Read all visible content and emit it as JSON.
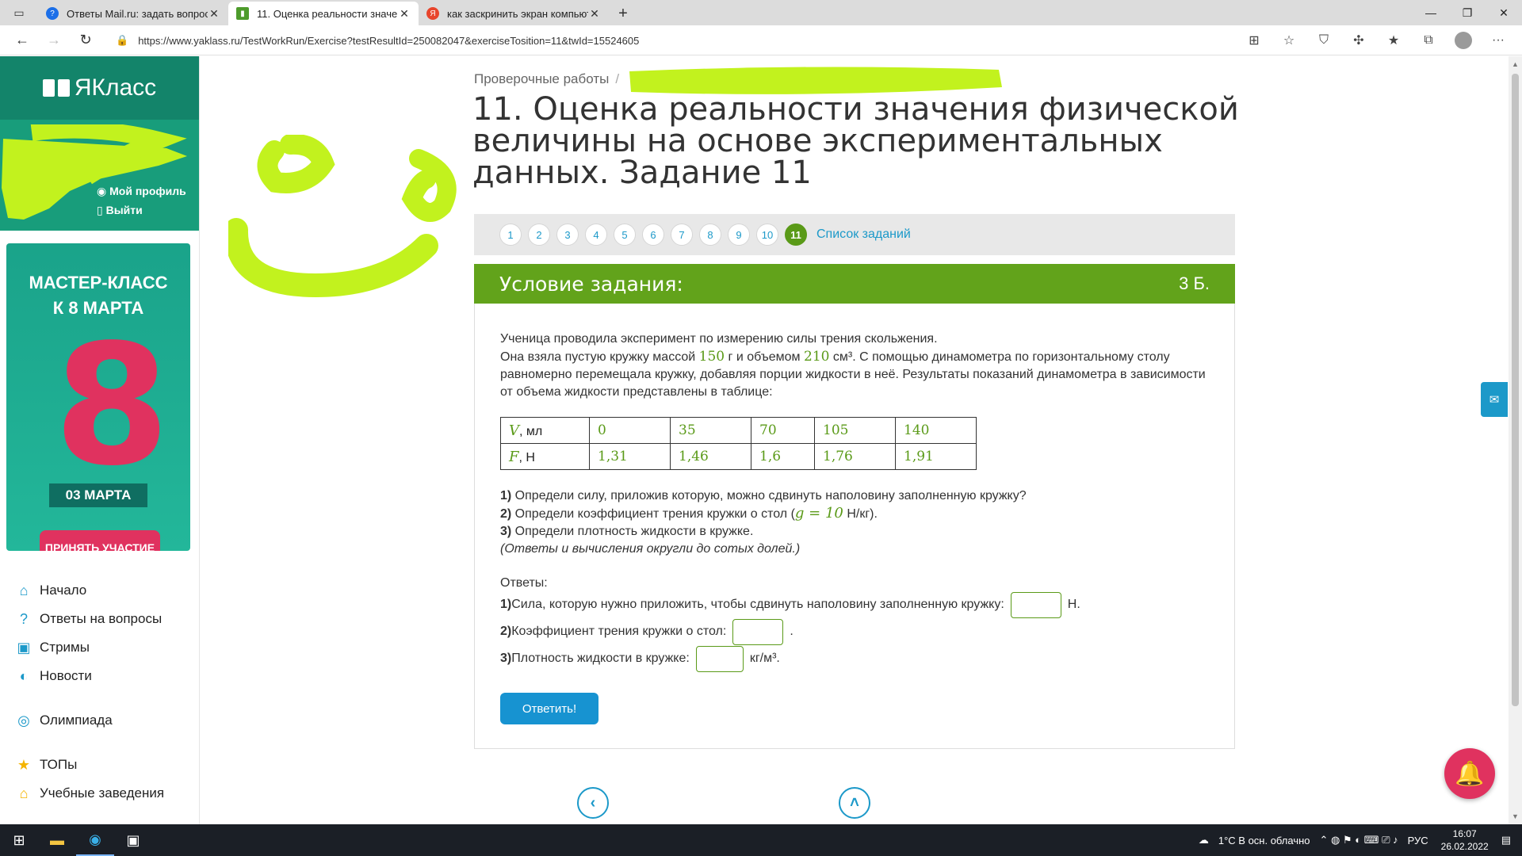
{
  "browser": {
    "tabs": [
      {
        "title": "Ответы Mail.ru: задать вопрос",
        "favicon_color": "#1c6fe8",
        "active": false
      },
      {
        "title": "11. Оценка реальности значен...",
        "favicon_color": "#4d9b2b",
        "active": true
      },
      {
        "title": "как заскринить экран компьют...",
        "favicon_color": "#e8452c",
        "active": false
      }
    ],
    "url": "https://www.yaklass.ru/TestWorkRun/Exercise?testResultId=250082047&exerciseTosition=11&twId=15524605",
    "icons": [
      "back-icon",
      "forward-icon",
      "refresh-icon",
      "lock-icon",
      "collections-icon",
      "favorite-add-icon",
      "shield-icon",
      "extensions-icon",
      "favorites-icon",
      "tab-collections-icon",
      "profile-avatar",
      "more-icon"
    ]
  },
  "site": {
    "logo_text": "ЯКласс",
    "profile": {
      "my_profile": "Мой профиль",
      "logout": "Выйти"
    },
    "banner": {
      "title_line1": "МАСТЕР-КЛАСС",
      "title_line2": "К 8 МАРТА",
      "big": "8",
      "date": "03 МАРТА",
      "button": "ПРИНЯТЬ УЧАСТИЕ"
    },
    "nav": [
      "Начало",
      "Ответы на вопросы",
      "Стримы",
      "Новости",
      "Олимпиада",
      "ТОПы",
      "Учебные заведения"
    ]
  },
  "exercise": {
    "breadcrumb": "Проверочные работы",
    "breadcrumb_sep": "/",
    "title": "11. Оценка реальности значения физической величины на основе экспериментальных данных. Задание 11",
    "pages": [
      "1",
      "2",
      "3",
      "4",
      "5",
      "6",
      "7",
      "8",
      "9",
      "10",
      "11"
    ],
    "current_page": "11",
    "task_list_link": "Список заданий",
    "condition_header": "Условие задания:",
    "score": "3 Б.",
    "text_line1": "Ученица проводила эксперимент по измерению силы трения скольжения.",
    "text_line2_a": "Она взяла пустую кружку массой ",
    "mass": "150",
    "text_line2_b": " г и объемом ",
    "volume": "210",
    "text_line2_c": " см³.  С помощью динамометра по горизонтальному столу равномерно перемещала кружку, добавляя порции жидкости в неё. Результаты показаний динамометра в зависимости от объема жидкости представлены в таблице:",
    "table": {
      "row_v_var": "V",
      "row_v_unit": ", мл",
      "row_f_var": "F",
      "row_f_unit": ", Н",
      "v_values": [
        "0",
        "35",
        "70",
        "105",
        "140"
      ],
      "f_values": [
        "1,31",
        "1,46",
        "1,6",
        "1,76",
        "1,91"
      ]
    },
    "q1_num": "1)",
    "q1": " Определи силу, приложив которую, можно сдвинуть наполовину заполненную кружку?",
    "q2_num": "2)",
    "q2_a": " Определи коэффициент трения кружки о стол (",
    "q2_g": "g = 10",
    "q2_b": " Н/кг).",
    "q3_num": "3)",
    "q3": " Определи плотность жидкости в кружке.",
    "note": "(Ответы и вычисления округли до сотых долей.)",
    "answers_label": "Ответы:",
    "a1_num": "1)",
    "a1": " Сила, которую нужно приложить, чтобы сдвинуть наполовину заполненную кружку:",
    "a1_unit": "Н.",
    "a2_num": "2)",
    "a2": " Коэффициент трения кружки о стол:",
    "a2_unit": ".",
    "a3_num": "3)",
    "a3": " Плотность жидкости в кружке:",
    "a3_unit": "кг/м³.",
    "submit": "Ответить!",
    "answer_values": [
      "",
      "",
      ""
    ]
  },
  "taskbar": {
    "weather": "1°C  В осн. облачно",
    "lang": "РУС",
    "time": "16:07",
    "date": "26.02.2022"
  },
  "colors": {
    "brand_green": "#62a31b",
    "logo_teal": "#13846a",
    "link_blue": "#1c99c9",
    "accent_pink": "#e0325f",
    "highlighter": "#c2f21e"
  }
}
